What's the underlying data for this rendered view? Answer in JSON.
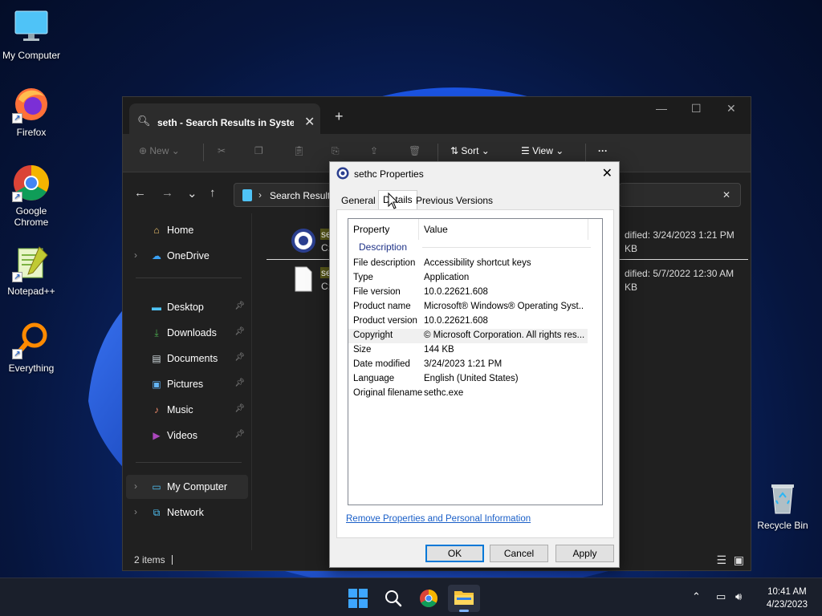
{
  "desktop": {
    "icons": [
      {
        "label": "My Computer"
      },
      {
        "label": "Firefox"
      },
      {
        "label": "Google Chrome"
      },
      {
        "label": "Notepad++"
      },
      {
        "label": "Everything"
      },
      {
        "label": "Recycle Bin"
      }
    ]
  },
  "explorer": {
    "tab_title": "seth - Search Results in Syster",
    "toolbar": {
      "new_label": "New",
      "sort_label": "Sort",
      "view_label": "View",
      "more_label": "···"
    },
    "address_text": "Search Results",
    "sidebar": {
      "items": [
        {
          "label": "Home",
          "icon": "home-icon"
        },
        {
          "label": "OneDrive",
          "icon": "cloud-icon"
        },
        {
          "label": "Desktop",
          "icon": "desktop-folder-icon"
        },
        {
          "label": "Downloads",
          "icon": "download-icon"
        },
        {
          "label": "Documents",
          "icon": "document-icon"
        },
        {
          "label": "Pictures",
          "icon": "picture-icon"
        },
        {
          "label": "Music",
          "icon": "music-icon"
        },
        {
          "label": "Videos",
          "icon": "video-icon"
        },
        {
          "label": "My Computer",
          "icon": "computer-icon"
        },
        {
          "label": "Network",
          "icon": "network-icon"
        }
      ]
    },
    "results": [
      {
        "name_partial": "se",
        "path_partial": "C:",
        "modified": "dified: 3/24/2023 1:21 PM",
        "size": "KB"
      },
      {
        "name_partial": "se",
        "path_partial": "C:",
        "modified": "dified: 5/7/2022 12:30 AM",
        "size": "KB"
      }
    ],
    "status": "2 items"
  },
  "dialog": {
    "title": "sethc Properties",
    "tabs": [
      "General",
      "Details",
      "Previous Versions"
    ],
    "columns": {
      "property": "Property",
      "value": "Value"
    },
    "section": "Description",
    "rows": [
      {
        "name": "File description",
        "value": "Accessibility shortcut keys"
      },
      {
        "name": "Type",
        "value": "Application"
      },
      {
        "name": "File version",
        "value": "10.0.22621.608"
      },
      {
        "name": "Product name",
        "value": "Microsoft® Windows® Operating Syst..."
      },
      {
        "name": "Product version",
        "value": "10.0.22621.608"
      },
      {
        "name": "Copyright",
        "value": "© Microsoft Corporation. All rights res..."
      },
      {
        "name": "Size",
        "value": "144 KB"
      },
      {
        "name": "Date modified",
        "value": "3/24/2023 1:21 PM"
      },
      {
        "name": "Language",
        "value": "English (United States)"
      },
      {
        "name": "Original filename",
        "value": "sethc.exe"
      }
    ],
    "remove_link": "Remove Properties and Personal Information",
    "buttons": {
      "ok": "OK",
      "cancel": "Cancel",
      "apply": "Apply"
    }
  },
  "taskbar": {
    "time": "10:41 AM",
    "date": "4/23/2023"
  },
  "colors": {
    "accent": "#0078d7",
    "link": "#1a5fc8",
    "explorer_bg": "#202020"
  }
}
